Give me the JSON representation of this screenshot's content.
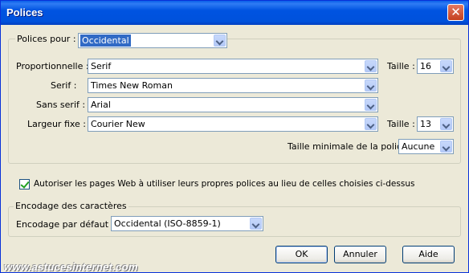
{
  "window": {
    "title": "Polices",
    "close_glyph": "✕"
  },
  "fonts_group": {
    "fonts_for_label": "Polices pour :",
    "fonts_for_value": "Occidental",
    "proportional_label": "Proportionnelle :",
    "proportional_value": "Serif",
    "size_label_1": "Taille :",
    "size_value_1": "16",
    "serif_label": "Serif :",
    "serif_value": "Times New Roman",
    "sans_serif_label": "Sans serif :",
    "sans_serif_value": "Arial",
    "monospace_label": "Largeur fixe :",
    "monospace_value": "Courier New",
    "size_label_2": "Taille :",
    "size_value_2": "13",
    "min_size_label": "Taille minimale de la police :",
    "min_size_value": "Aucune"
  },
  "allow_pages_checkbox": {
    "label": "Autoriser les pages Web à utiliser leurs propres polices au lieu de celles choisies ci-dessus",
    "checked": true
  },
  "encoding_group": {
    "title": "Encodage des caractères",
    "default_label": "Encodage par défaut :",
    "default_value": "Occidental (ISO-8859-1)"
  },
  "buttons": {
    "ok": "OK",
    "cancel": "Annuler",
    "help": "Aide"
  },
  "watermark": "www.astucesinternet.com",
  "colors": {
    "titlebar": "#0053e1",
    "dialog_bg": "#ece9d8",
    "selection": "#316ac5"
  }
}
